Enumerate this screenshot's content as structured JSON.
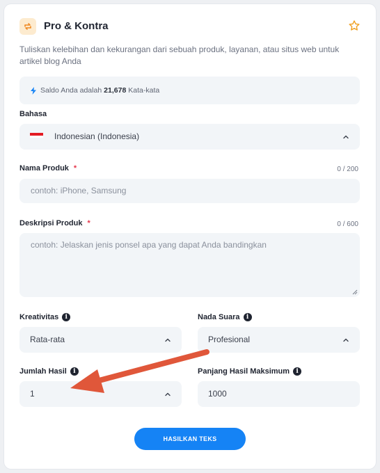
{
  "header": {
    "title": "Pro & Kontra",
    "icon": "repeat-icon",
    "favorite_icon": "star-icon"
  },
  "description": "Tuliskan kelebihan dan kekurangan dari sebuah produk, layanan, atau situs web untuk artikel blog Anda",
  "balance": {
    "prefix": "Saldo Anda adalah",
    "amount": "21,678",
    "suffix": "Kata-kata",
    "icon": "bolt-icon"
  },
  "language": {
    "label": "Bahasa",
    "value": "Indonesian (Indonesia)",
    "flag_colors": [
      "#e31b23",
      "#ffffff"
    ]
  },
  "product_name": {
    "label": "Nama Produk",
    "required": "*",
    "counter": "0 / 200",
    "placeholder": "contoh: iPhone, Samsung"
  },
  "product_description": {
    "label": "Deskripsi Produk",
    "required": "*",
    "counter": "0 / 600",
    "placeholder": "contoh: Jelaskan jenis ponsel apa yang dapat Anda bandingkan"
  },
  "creativity": {
    "label": "Kreativitas",
    "value": "Rata-rata"
  },
  "tone": {
    "label": "Nada Suara",
    "value": "Profesional"
  },
  "result_count": {
    "label": "Jumlah Hasil",
    "value": "1"
  },
  "max_length": {
    "label": "Panjang Hasil Maksimum",
    "value": "1000"
  },
  "submit_label": "HASILKAN TEKS",
  "colors": {
    "accent": "#1583f5",
    "annotation_arrow": "#e0573a",
    "required": "#e5384d"
  }
}
